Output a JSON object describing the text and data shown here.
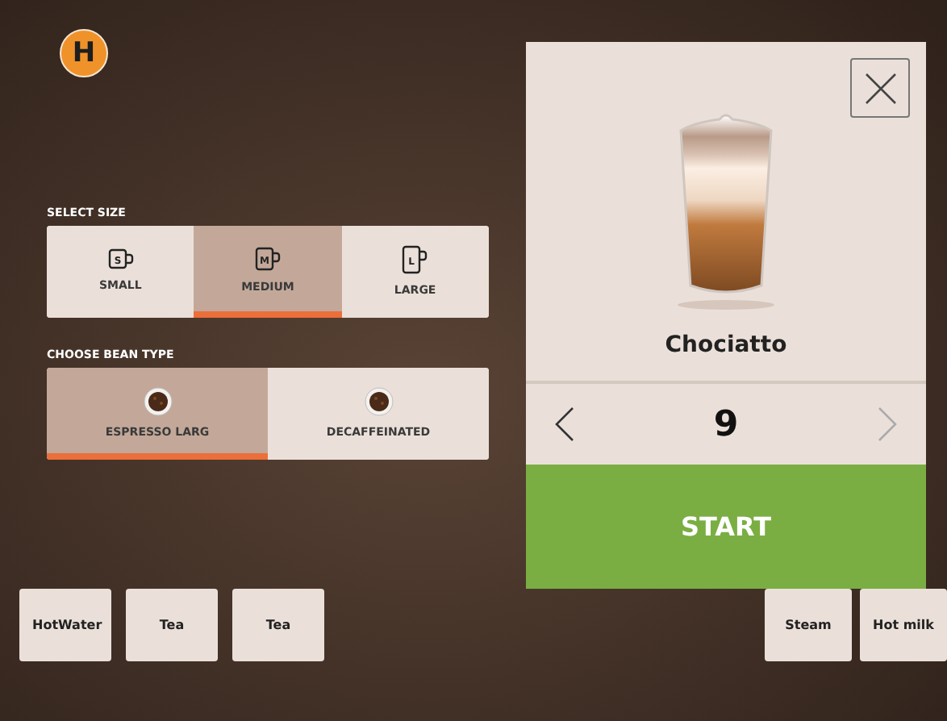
{
  "logo": {
    "letter": "H"
  },
  "size": {
    "label": "SELECT SIZE",
    "options": [
      {
        "label": "SMALL",
        "icon_letter": "S",
        "kind": "small",
        "selected": false
      },
      {
        "label": "MEDIUM",
        "icon_letter": "M",
        "kind": "medium",
        "selected": true
      },
      {
        "label": "LARGE",
        "icon_letter": "L",
        "kind": "large",
        "selected": false
      }
    ]
  },
  "bean": {
    "label": "CHOOSE BEAN TYPE",
    "options": [
      {
        "label": "ESPRESSO LARG",
        "selected": true
      },
      {
        "label": "DECAFFEINATED",
        "selected": false
      }
    ]
  },
  "drink": {
    "name": "Chociatto",
    "count": "9",
    "prev": {
      "disabled": false
    },
    "next": {
      "disabled": true
    },
    "start": "START"
  },
  "bottom_left": [
    "HotWater",
    "Tea",
    "Tea"
  ],
  "bottom_right": [
    "Steam",
    "Hot milk"
  ]
}
